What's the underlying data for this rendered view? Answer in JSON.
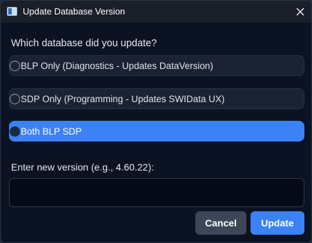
{
  "window": {
    "title": "Update Database Version"
  },
  "dialog": {
    "question": "Which database did you update?",
    "options": [
      {
        "label": "BLP Only (Diagnostics - Updates DataVersion)",
        "selected": false
      },
      {
        "label": "SDP Only (Programming - Updates SWIData  UX)",
        "selected": false
      },
      {
        "label": "Both BLP  SDP",
        "selected": true
      }
    ],
    "version_label": "Enter new version (e.g., 4.60.22):",
    "version_value": "",
    "cancel_label": "Cancel",
    "update_label": "Update"
  },
  "colors": {
    "accent": "#3b82f6",
    "background": "#0b1222",
    "titlebar": "#1a1f2a",
    "option_bg": "#1a2233",
    "cancel_bg": "#3c4656"
  },
  "icons": {
    "app": "app-window-icon",
    "close": "close-icon"
  }
}
